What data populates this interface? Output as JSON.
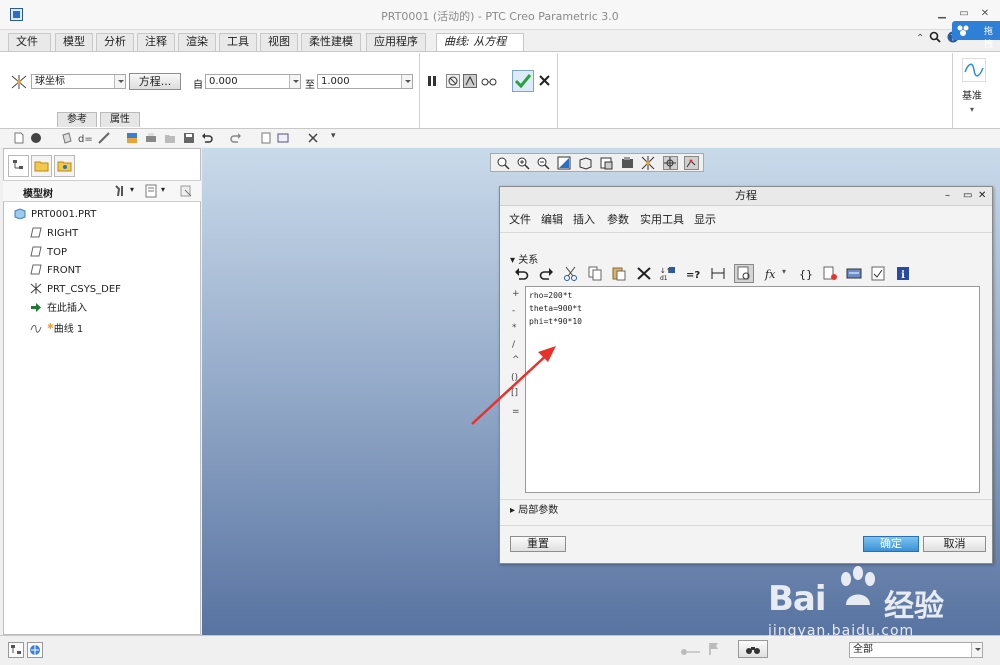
{
  "window": {
    "title": "PRT0001 (活动的) - PTC Creo Parametric 3.0",
    "watermark_corner": "拖拽"
  },
  "ribbon": {
    "tabs": [
      {
        "label": "文件",
        "has_dropdown": true
      },
      {
        "label": "模型"
      },
      {
        "label": "分析"
      },
      {
        "label": "注释"
      },
      {
        "label": "渲染"
      },
      {
        "label": "工具"
      },
      {
        "label": "视图"
      },
      {
        "label": "柔性建模"
      },
      {
        "label": "应用程序"
      },
      {
        "label": "曲线: 从方程",
        "active": true
      }
    ],
    "coord_system": "球坐标",
    "equation_button": "方程...",
    "from_label": "自",
    "from_value": "0.000",
    "to_label": "至",
    "to_value": "1.000",
    "sub_tabs": [
      "参考",
      "属性"
    ],
    "datum_label": "基准"
  },
  "model_tree": {
    "header_label": "模型树",
    "items": [
      {
        "label": "PRT0001.PRT",
        "icon": "part-icon"
      },
      {
        "label": "RIGHT",
        "icon": "datum-plane-icon"
      },
      {
        "label": "TOP",
        "icon": "datum-plane-icon"
      },
      {
        "label": "FRONT",
        "icon": "datum-plane-icon"
      },
      {
        "label": "PRT_CSYS_DEF",
        "icon": "csys-icon"
      },
      {
        "label": "在此插入",
        "icon": "insert-arrow-icon"
      },
      {
        "label": "曲线 1",
        "icon": "curve-icon"
      }
    ]
  },
  "dialog": {
    "title": "方程",
    "menu": [
      "文件",
      "编辑",
      "插入",
      "参数",
      "实用工具",
      "显示"
    ],
    "relations_label": "关系",
    "operators": [
      "+",
      "-",
      "*",
      "/",
      "^",
      "()",
      "[]",
      "="
    ],
    "relations": [
      "rho=200*t",
      "theta=900*t",
      "phi=t*90*10"
    ],
    "local_params_label": "局部参数",
    "reset_button": "重置",
    "ok_button": "确定",
    "cancel_button": "取消"
  },
  "status_bar": {
    "filter_value": "全部"
  },
  "watermark": {
    "brand": "Bai",
    "brand_cn": "经验",
    "url": "jingyan.baidu.com"
  },
  "colors": {
    "accent": "#3a91d6",
    "check_green": "#27a33c",
    "arrow_red": "#e8312a",
    "viewport_top": "#c9daea",
    "viewport_bottom": "#5873a1"
  }
}
